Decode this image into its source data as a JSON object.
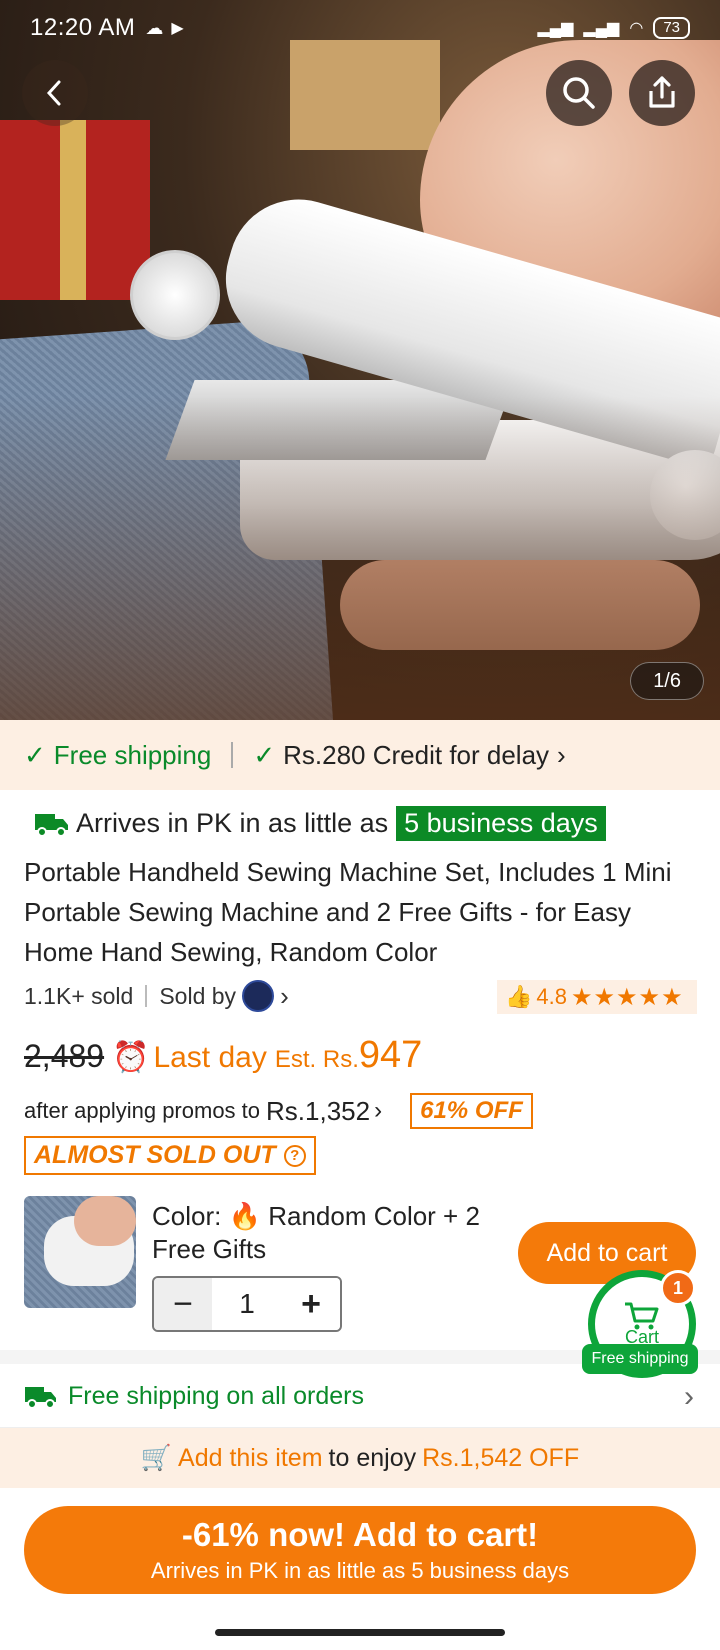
{
  "status": {
    "time": "12:20 AM",
    "battery": "73"
  },
  "gallery": {
    "counter": "1/6"
  },
  "shipping_banner": {
    "free": "Free shipping",
    "credit": "Rs.280 Credit for delay"
  },
  "delivery": {
    "prefix": "Arrives in PK in as little as",
    "days": "5 business days"
  },
  "product": {
    "title": "Portable Handheld Sewing Machine Set, Includes 1 Mini Portable Sewing Machine and 2 Free Gifts - for Easy Home Hand Sewing, Random Color",
    "sold": "1.1K+ sold",
    "sold_by": "Sold by",
    "rating": "4.8",
    "stars": "★★★★★"
  },
  "price": {
    "original": "2,489",
    "last_day": "Last day",
    "est_label": "Est. Rs.",
    "est_value": "947",
    "promo_text": "after applying promos to",
    "promo_value": "Rs.1,352",
    "off": "61% OFF",
    "almost_sold_out": "ALMOST SOLD OUT"
  },
  "variant": {
    "color_label": "Color:",
    "color_value": "Random Color + 2 Free Gifts",
    "quantity": "1",
    "minus": "−",
    "plus": "+"
  },
  "cart": {
    "add_label": "Add to cart",
    "label": "Cart",
    "count": "1",
    "free_shipping": "Free shipping"
  },
  "free_all": {
    "text": "Free shipping on all orders"
  },
  "enjoy": {
    "add_item": "Add this item",
    "middle": "to enjoy",
    "amount": "Rs.1,542 OFF"
  },
  "cta": {
    "title": "-61% now! Add to cart!",
    "subtitle": "Arrives in PK in as little as 5 business days"
  },
  "colors": {
    "accent": "#f47a0a",
    "green": "#0a8a2a",
    "banner_bg": "#fdefe3"
  }
}
